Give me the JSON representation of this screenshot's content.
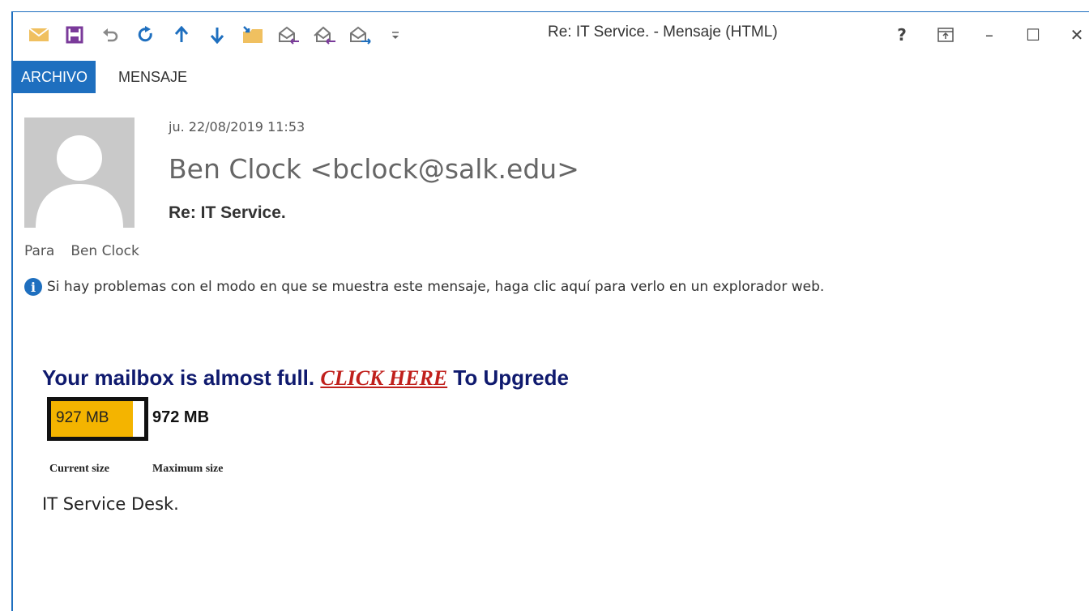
{
  "window": {
    "title": "Re: IT Service. - Mensaje (HTML)",
    "accent_color": "#1e6fbf",
    "controls": {
      "help": "?",
      "ribbon_display": "ribbon-display-icon",
      "minimize": "–",
      "maximize": "☐",
      "close": "✕"
    }
  },
  "quick_access_toolbar": [
    {
      "name": "mail-icon"
    },
    {
      "name": "save-icon"
    },
    {
      "name": "undo-icon"
    },
    {
      "name": "redo-icon"
    },
    {
      "name": "previous-item-icon"
    },
    {
      "name": "next-item-icon"
    },
    {
      "name": "move-to-folder-icon"
    },
    {
      "name": "reply-icon"
    },
    {
      "name": "reply-all-icon"
    },
    {
      "name": "forward-icon"
    },
    {
      "name": "customize-toolbar-icon"
    }
  ],
  "ribbon": {
    "tabs": [
      {
        "label": "ARCHIVO",
        "active": true
      },
      {
        "label": "MENSAJE",
        "active": false
      }
    ]
  },
  "message": {
    "date": "ju. 22/08/2019 11:53",
    "sender": "Ben Clock <bclock@salk.edu>",
    "subject": "Re: IT Service.",
    "to_label": "Para",
    "to_value": "Ben Clock",
    "info_bar": "Si hay problemas con el modo en que se muestra este mensaje, haga clic aquí para verlo en un explorador web."
  },
  "body": {
    "headline_prefix": "Your mailbox is almost full.",
    "headline_link": "CLICK HERE",
    "headline_suffix": "To Upgrede",
    "current_size": "927 MB",
    "maximum_size": "972 MB",
    "fill_fraction": 0.88,
    "fill_color": "#f4b400",
    "current_size_label": "Current size",
    "maximum_size_label": "Maximum size",
    "signature": "IT Service Desk."
  }
}
